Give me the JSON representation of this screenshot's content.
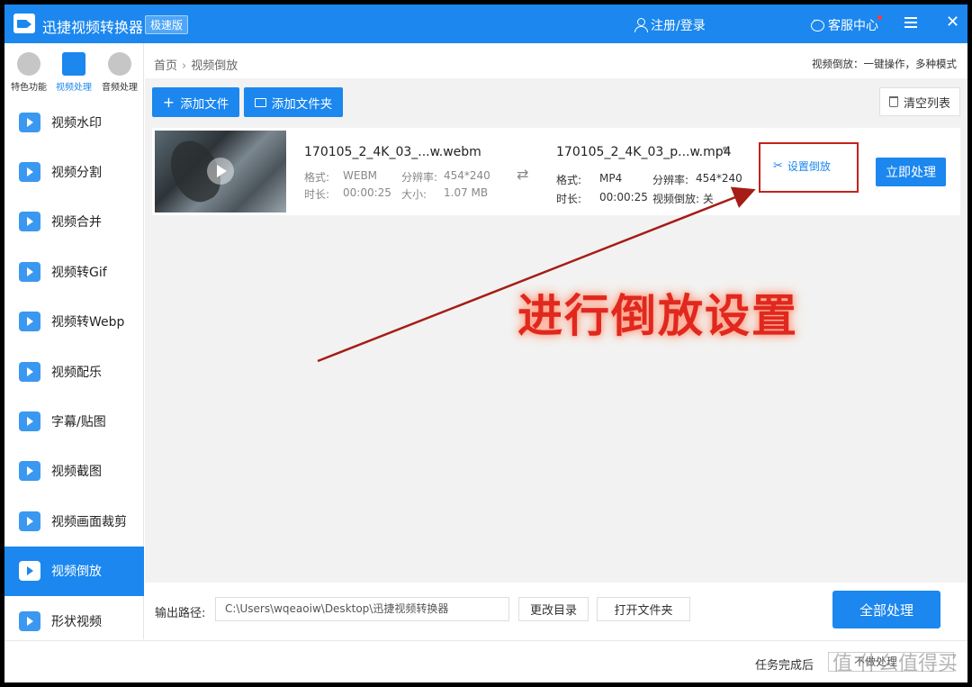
{
  "titlebar": {
    "app_title": "迅捷视频转换器",
    "edition": "极速版",
    "login": "注册/登录",
    "support": "客服中心",
    "close": "✕"
  },
  "sidebar": {
    "categories": [
      {
        "label": "特色功能",
        "icon": "star-icon"
      },
      {
        "label": "视频处理",
        "icon": "film-icon",
        "active": true
      },
      {
        "label": "音频处理",
        "icon": "music-icon"
      }
    ],
    "items": [
      {
        "label": "视频水印",
        "icon": "watermark-icon"
      },
      {
        "label": "视频分割",
        "icon": "split-icon"
      },
      {
        "label": "视频合并",
        "icon": "merge-icon"
      },
      {
        "label": "视频转Gif",
        "icon": "gif-icon"
      },
      {
        "label": "视频转Webp",
        "icon": "webp-icon"
      },
      {
        "label": "视频配乐",
        "icon": "music-video-icon"
      },
      {
        "label": "字幕/贴图",
        "icon": "subtitle-star-icon"
      },
      {
        "label": "视频截图",
        "icon": "screenshot-icon"
      },
      {
        "label": "视频画面裁剪",
        "icon": "crop-icon"
      },
      {
        "label": "视频倒放",
        "icon": "reverse-icon",
        "active": true
      },
      {
        "label": "形状视频",
        "icon": "shape-icon"
      }
    ]
  },
  "breadcrumb": {
    "home": "首页",
    "sep": "›",
    "current": "视频倒放"
  },
  "feature_desc": "视频倒放：一键操作，多种模式",
  "toolbar": {
    "add_file": "添加文件",
    "add_folder": "添加文件夹",
    "clear_list": "清空列表"
  },
  "file": {
    "source_name": "170105_2_4K_03_...w.webm",
    "source_format_label": "格式:",
    "source_format": "WEBM",
    "source_res_label": "分辨率:",
    "source_res": "454*240",
    "source_duration_label": "时长:",
    "source_duration": "00:00:25",
    "source_size_label": "大小:",
    "source_size": "1.07 MB",
    "output_name": "170105_2_4K_03_p...w.mp4",
    "output_format_label": "格式:",
    "output_format": "MP4",
    "output_res_label": "分辨率:",
    "output_res": "454*240",
    "output_duration_label": "时长:",
    "output_duration": "00:00:25",
    "output_reverse": "视频倒放: 关",
    "set_reverse": "设置倒放",
    "process_now": "立即处理"
  },
  "output": {
    "label": "输出路径:",
    "path": "C:\\Users\\wqeaoiw\\Desktop\\迅捷视频转换器",
    "change_dir": "更改目录",
    "open_folder": "打开文件夹",
    "process_all": "全部处理"
  },
  "status": {
    "after_task": "任务完成后",
    "action": "不做处理"
  },
  "annotation": {
    "text": "进行倒放设置",
    "color": "#e0281f"
  },
  "watermark": "值 什么值得买",
  "colors": {
    "accent": "#1b87ef",
    "annotation_red": "#c4231a"
  }
}
